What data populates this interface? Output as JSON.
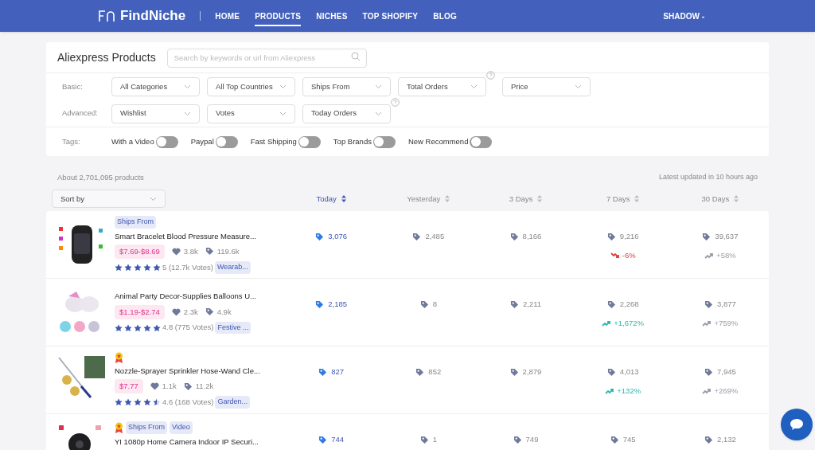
{
  "nav": {
    "logo": "FindNiche",
    "links": [
      {
        "label": "HOME",
        "selected": false
      },
      {
        "label": "PRODUCTS",
        "selected": true
      },
      {
        "label": "NICHES",
        "selected": false
      },
      {
        "label": "TOP SHOPIFY",
        "selected": false
      },
      {
        "label": "BLOG",
        "selected": false
      }
    ],
    "user": "SHADOW -"
  },
  "filters": {
    "title": "Aliexpress Products",
    "search": {
      "placeholder": "Search by keywords or url from Aliexpress"
    },
    "rows": [
      {
        "label": "Basic:",
        "dropdowns": [
          {
            "label": "All Categories",
            "help": false
          },
          {
            "label": "All Top Countries",
            "help": false
          },
          {
            "label": "Ships From",
            "help": false
          },
          {
            "label": "Total Orders",
            "help": true
          },
          {
            "label": "Price",
            "help": false
          }
        ]
      },
      {
        "label": "Advanced:",
        "dropdowns": [
          {
            "label": "Wishlist",
            "help": false
          },
          {
            "label": "Votes",
            "help": false
          },
          {
            "label": "Today Orders",
            "help": true
          }
        ]
      }
    ],
    "tags": {
      "label": "Tags:",
      "toggles": [
        {
          "label": "With a Video",
          "on": false
        },
        {
          "label": "Paypal",
          "on": false
        },
        {
          "label": "Fast Shipping",
          "on": false
        },
        {
          "label": "Top Brands",
          "on": false
        },
        {
          "label": "New Recommend",
          "on": false
        }
      ]
    }
  },
  "summary": {
    "count": "About 2,701,095 products",
    "updated": "Latest updated in 10 hours ago"
  },
  "sort": {
    "placeholder": "Sort by"
  },
  "columns": [
    {
      "label": "Today",
      "selected": true
    },
    {
      "label": "Yesterday",
      "selected": false
    },
    {
      "label": "3 Days",
      "selected": false
    },
    {
      "label": "7 Days",
      "selected": false
    },
    {
      "label": "30 Days",
      "selected": false
    }
  ],
  "products": [
    {
      "kind": "picture",
      "medal": false,
      "badges": [
        "Ships From"
      ],
      "title": "Smart Bracelet Blood Pressure Measure...",
      "price": "$7.69-$8.69",
      "wishes": "3.8k",
      "orders": "119.6k",
      "stars": 5,
      "rating": "5 (12.7k Votes)",
      "category": "Wearab...",
      "values": [
        {
          "value": "3,076"
        },
        {
          "value": "2,485"
        },
        {
          "value": "8,166"
        },
        {
          "value": "9,216",
          "trend": {
            "text": "-6%",
            "kind": "down",
            "color": "#e0403a"
          }
        },
        {
          "value": "39,637",
          "trend": {
            "text": "+58%",
            "kind": "up",
            "color": "#9a9ca6"
          }
        }
      ]
    },
    {
      "kind": "picture",
      "medal": false,
      "title": "Animal Party Decor-Supplies Balloons U...",
      "price": "$1.19-$2.74",
      "wishes": "2.3k",
      "orders": "4.9k",
      "stars": 5,
      "rating": "4.8 (775 Votes)",
      "category": "Festive ...",
      "values": [
        {
          "value": "2,185"
        },
        {
          "value": "8"
        },
        {
          "value": "2,211"
        },
        {
          "value": "2,268",
          "trend": {
            "text": "+1,672%",
            "kind": "up",
            "color": "#27b8b0"
          }
        },
        {
          "value": "3,877",
          "trend": {
            "text": "+759%",
            "kind": "up",
            "color": "#9a9ca6"
          }
        }
      ]
    },
    {
      "kind": "picture",
      "medal": true,
      "title": "Nozzle-Sprayer Sprinkler Hose-Wand Cle...",
      "price": "$7.77",
      "wishes": "1.1k",
      "orders": "11.2k",
      "stars": 4.5,
      "rating": "4.6 (168 Votes)",
      "category": "Garden...",
      "values": [
        {
          "value": "827"
        },
        {
          "value": "852"
        },
        {
          "value": "2,879"
        },
        {
          "value": "4,013",
          "trend": {
            "text": "+132%",
            "kind": "up",
            "color": "#27b8b0"
          }
        },
        {
          "value": "7,945",
          "trend": {
            "text": "+269%",
            "kind": "up",
            "color": "#9a9ca6"
          }
        }
      ]
    },
    {
      "kind": "picture",
      "medal": true,
      "badges": [
        "Ships From",
        "Video"
      ],
      "title": "YI 1080p Home Camera Indoor IP Securi...",
      "values": [
        {
          "value": "744"
        },
        {
          "value": "1"
        },
        {
          "value": "749"
        },
        {
          "value": "745"
        },
        {
          "value": "2,132"
        }
      ]
    }
  ]
}
